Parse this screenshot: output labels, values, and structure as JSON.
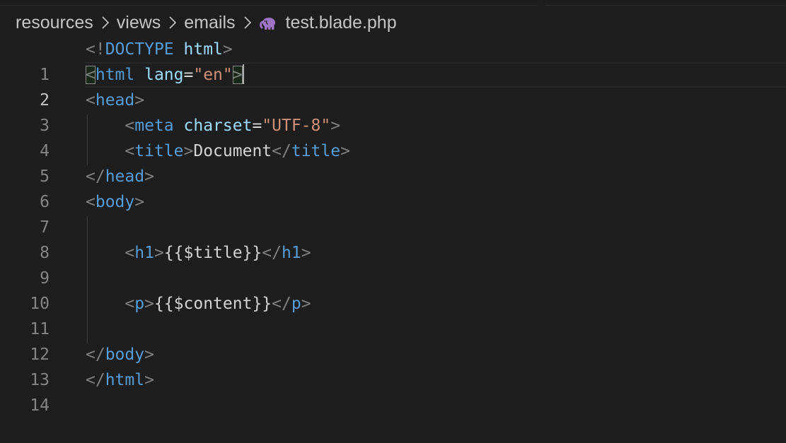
{
  "breadcrumb": {
    "items": [
      "resources",
      "views",
      "emails"
    ],
    "file_icon": "php-elephant-icon",
    "file_name": "test.blade.php"
  },
  "editor": {
    "active_line": 2,
    "lines": [
      {
        "number": "1"
      },
      {
        "number": "2"
      },
      {
        "number": "3"
      },
      {
        "number": "4"
      },
      {
        "number": "5"
      },
      {
        "number": "6"
      },
      {
        "number": "7"
      },
      {
        "number": "8"
      },
      {
        "number": "9"
      },
      {
        "number": "10"
      },
      {
        "number": "11"
      },
      {
        "number": "12"
      },
      {
        "number": "13"
      },
      {
        "number": "14"
      }
    ],
    "code": {
      "l1": {
        "open": "<!",
        "doctype": "DOCTYPE",
        "sp": " ",
        "attr": "html",
        "close": ">"
      },
      "l2": {
        "open": "<",
        "tag": "html",
        "sp": " ",
        "attr": "lang",
        "eq": "=",
        "val": "\"en\"",
        "close": ">"
      },
      "l3": {
        "open": "<",
        "tag": "head",
        "close": ">"
      },
      "l4": {
        "indent": "    ",
        "open": "<",
        "tag": "meta",
        "sp": " ",
        "attr": "charset",
        "eq": "=",
        "val": "\"UTF-8\"",
        "close": ">"
      },
      "l5": {
        "indent": "    ",
        "open": "<",
        "tag": "title",
        "close": ">",
        "text": "Document",
        "open2": "</",
        "tag2": "title",
        "close2": ">"
      },
      "l6": {
        "open": "</",
        "tag": "head",
        "close": ">"
      },
      "l7": {
        "open": "<",
        "tag": "body",
        "close": ">"
      },
      "l9": {
        "indent": "    ",
        "open": "<",
        "tag": "h1",
        "close": ">",
        "text": "{{$title}}",
        "open2": "</",
        "tag2": "h1",
        "close2": ">"
      },
      "l11": {
        "indent": "    ",
        "open": "<",
        "tag": "p",
        "close": ">",
        "text": "{{$content}}",
        "open2": "</",
        "tag2": "p",
        "close2": ">"
      },
      "l13": {
        "open": "</",
        "tag": "body",
        "close": ">"
      },
      "l14": {
        "open": "</",
        "tag": "html",
        "close": ">"
      }
    }
  },
  "colors": {
    "background": "#1e1e1e",
    "tag": "#569cd6",
    "attribute": "#9cdcfe",
    "string": "#ce9178",
    "bracket": "#808080",
    "text": "#d4d4d4",
    "line_number": "#858585"
  }
}
